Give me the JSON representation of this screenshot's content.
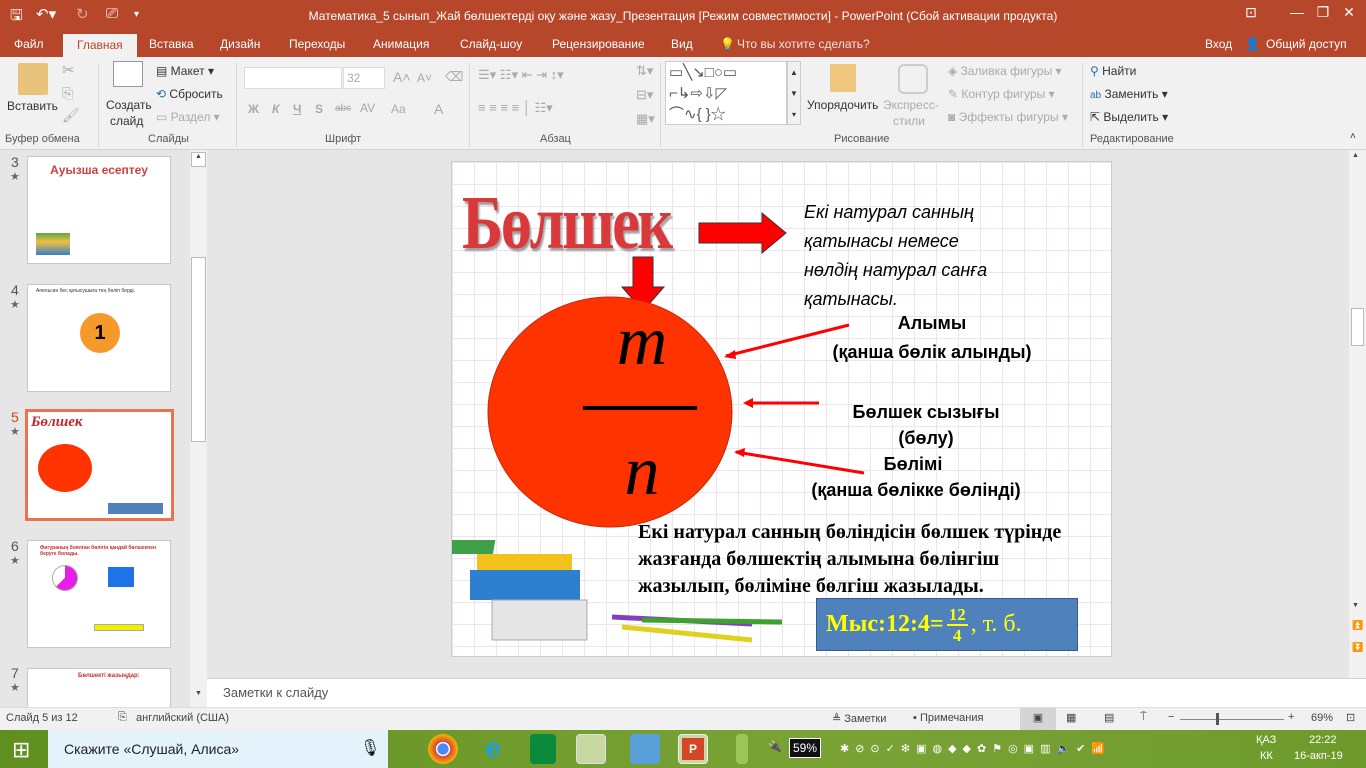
{
  "window": {
    "title": "Математика_5 сынып_Жай бөлшектерді оқу және жазу_Презентация [Режим совместимости] - PowerPoint (Сбой активации продукта)"
  },
  "tabs": [
    "Файл",
    "Главная",
    "Вставка",
    "Дизайн",
    "Переходы",
    "Анимация",
    "Слайд-шоу",
    "Рецензирование",
    "Вид"
  ],
  "tell_me": "Что вы хотите сделать?",
  "signin": "Вход",
  "share": "Общий доступ",
  "ribbon": {
    "clipboard": {
      "paste": "Вставить",
      "group": "Буфер обмена"
    },
    "slides": {
      "new_slide_1": "Создать",
      "new_slide_2": "слайд",
      "layout": "Макет",
      "reset": "Сбросить",
      "section": "Раздел",
      "group": "Слайды"
    },
    "font": {
      "font_name": "",
      "font_size": "32",
      "bold": "Ж",
      "italic": "К",
      "underline": "Ч",
      "shadow": "S",
      "strike": "abc",
      "spacing": "AV",
      "case": "Aa",
      "color": "A",
      "group": "Шрифт"
    },
    "paragraph": {
      "group": "Абзац"
    },
    "drawing": {
      "arrange": "Упорядочить",
      "quick_styles_1": "Экспресс-",
      "quick_styles_2": "стили",
      "fill": "Заливка фигуры",
      "outline": "Контур фигуры",
      "effects": "Эффекты фигуры",
      "group": "Рисование"
    },
    "editing": {
      "find": "Найти",
      "replace": "Заменить",
      "select": "Выделить",
      "group": "Редактирование"
    }
  },
  "thumbnails": [
    {
      "num": "3",
      "title": "Ауызша есептеу"
    },
    {
      "num": "4",
      "title": "Апельсин бес қатысушыға тең бөліп берді.",
      "center": "1"
    },
    {
      "num": "5",
      "title": "Бөлшек",
      "selected": true
    },
    {
      "num": "6",
      "title": "Фигураның боялған бөлігін қандай бөлшекпен беруге болады."
    },
    {
      "num": "7",
      "title": "Бөлшекті жазыңдар:"
    }
  ],
  "slide": {
    "title": "Бөлшек",
    "definition": [
      "Екі натурал санның",
      "қатынасы немесе",
      "нөлдің натурал санға",
      "қатынасы."
    ],
    "numerator_symbol": "m",
    "denominator_symbol": "n",
    "labels": {
      "numerator": "Алымы",
      "numerator_desc": "(қанша бөлік алынды)",
      "line": "Бөлшек сызығы",
      "line_desc": "(бөлу)",
      "denominator": "Бөлімі",
      "denominator_desc": "(қанша бөлікке бөлінді)"
    },
    "bottom_text": [
      "Екі натурал санның бөліндісін бөлшек түрінде",
      "жазғанда бөлшектің алымына бөлінгіш",
      "жазылып, бөліміне бөлгіш жазылады."
    ],
    "example": {
      "prefix": "Мыс:12:4=",
      "num": "12",
      "den": "4",
      "suffix": ", т. б."
    },
    "colors": {
      "circle": "#ff3300",
      "arrow": "#ff0000",
      "example_bg": "#4f81bd",
      "example_text": "#ffff00"
    }
  },
  "notes_placeholder": "Заметки к слайду",
  "status": {
    "slide": "Слайд 5 из 12",
    "language": "английский (США)",
    "notes": "Заметки",
    "comments": "Примечания",
    "zoom": "69%",
    "zoom_value": 69
  },
  "taskbar": {
    "search": "Скажите «Слушай, Алиса»",
    "battery": "59%",
    "lang1": "ҚАЗ",
    "lang2": "КК",
    "time": "22:22",
    "date": "16-акп-19"
  }
}
